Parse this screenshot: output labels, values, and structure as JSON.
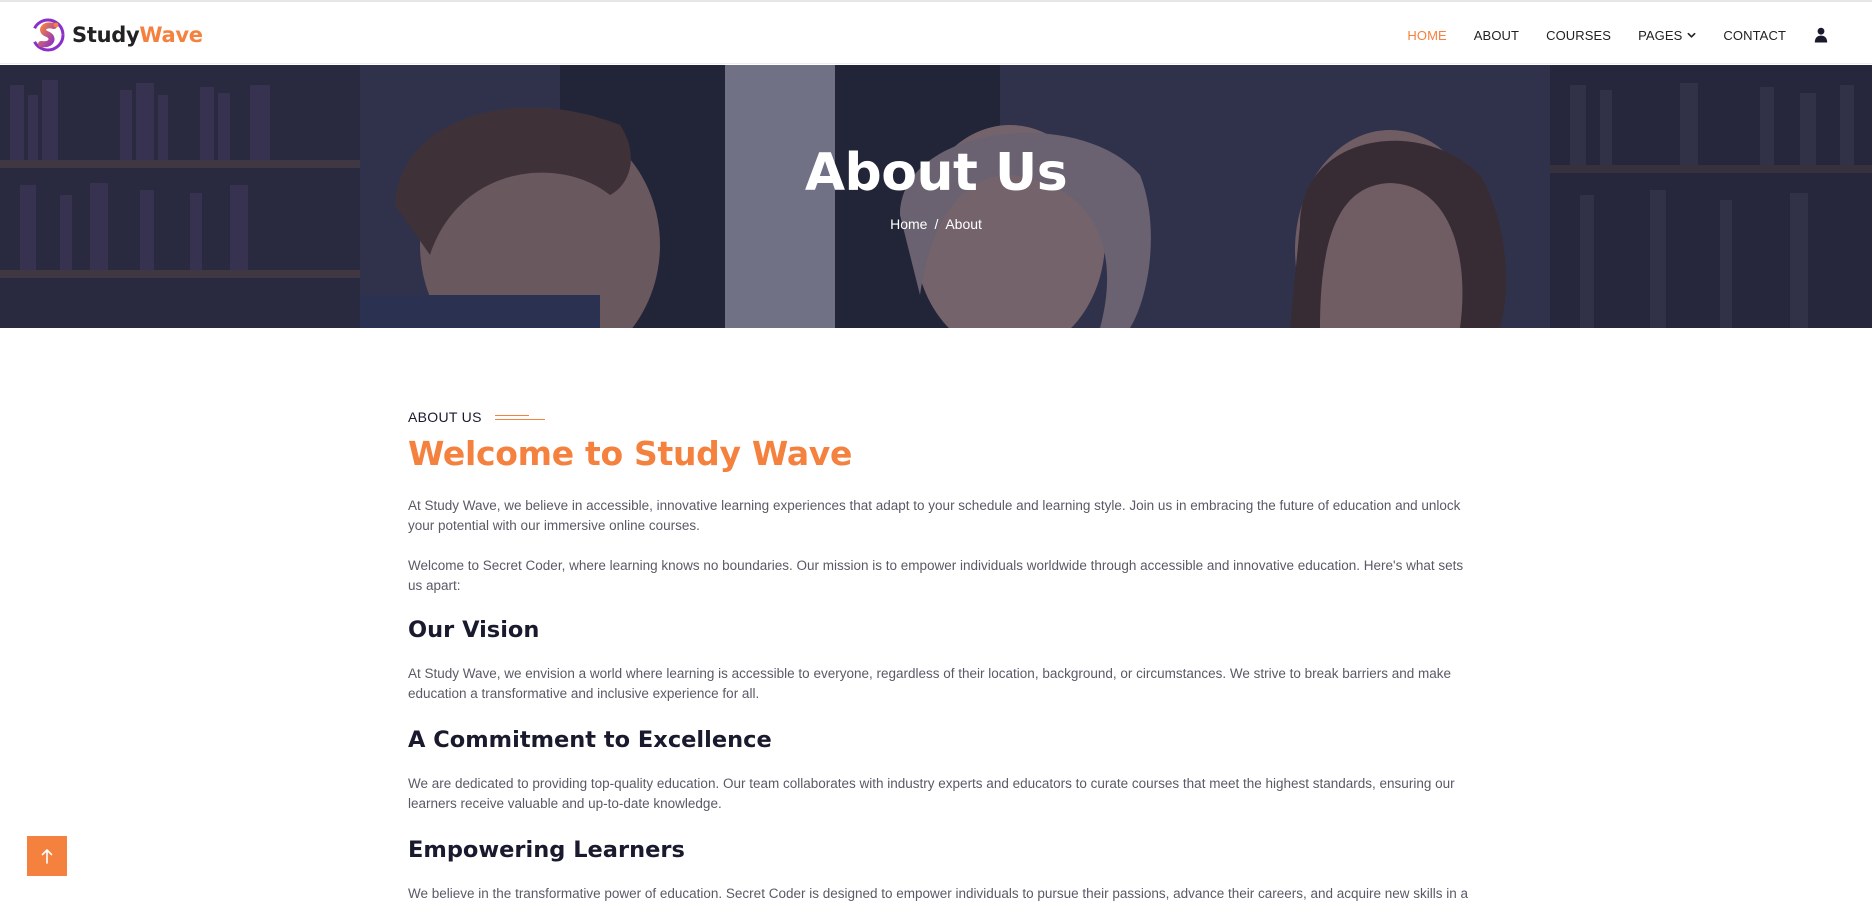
{
  "brand": {
    "name_part1": "Study",
    "name_part2": "Wave",
    "accent_color": "#f5813f",
    "logo_icon": "study-wave-s-logo"
  },
  "nav": {
    "items": [
      {
        "label": "HOME",
        "active": true
      },
      {
        "label": "ABOUT",
        "active": false
      },
      {
        "label": "COURSES",
        "active": false
      },
      {
        "label": "PAGES",
        "active": false,
        "has_dropdown": true
      },
      {
        "label": "CONTACT",
        "active": false
      }
    ],
    "user_icon": "user-icon"
  },
  "hero": {
    "title": "About Us",
    "breadcrumb": {
      "home": "Home",
      "separator": "/",
      "current": "About"
    }
  },
  "about": {
    "eyebrow": "ABOUT US",
    "heading": "Welcome to Study Wave",
    "intro_1": "At Study Wave, we believe in accessible, innovative learning experiences that adapt to your schedule and learning style. Join us in embracing the future of education and unlock your potential with our immersive online courses.",
    "intro_2": "Welcome to Secret Coder, where learning knows no boundaries. Our mission is to empower individuals worldwide through accessible and innovative education. Here's what sets us apart:",
    "sections": [
      {
        "title": "Our Vision",
        "text": "At Study Wave, we envision a world where learning is accessible to everyone, regardless of their location, background, or circumstances. We strive to break barriers and make education a transformative and inclusive experience for all."
      },
      {
        "title": "A Commitment to Excellence",
        "text": "We are dedicated to providing top-quality education. Our team collaborates with industry experts and educators to curate courses that meet the highest standards, ensuring our learners receive valuable and up-to-date knowledge."
      },
      {
        "title": "Empowering Learners",
        "text": "We believe in the transformative power of education. Secret Coder is designed to empower individuals to pursue their passions, advance their careers, and acquire new skills in a"
      }
    ]
  },
  "back_to_top": {
    "icon": "arrow-up-icon"
  }
}
